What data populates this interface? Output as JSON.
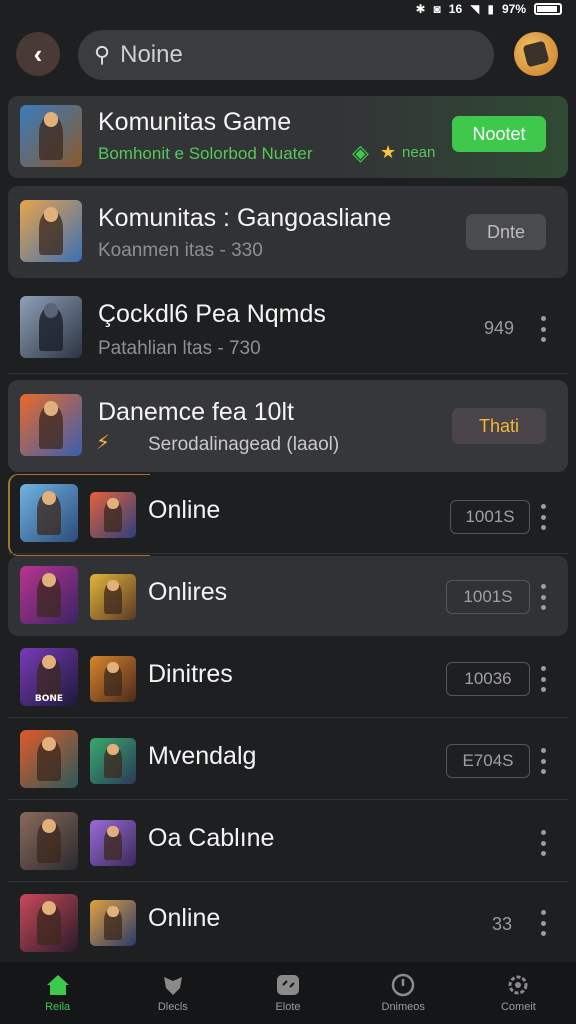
{
  "status": {
    "signal": "16",
    "battery": "97%"
  },
  "search": {
    "value": "Noine"
  },
  "rows": [
    {
      "title": "Komunitas Game",
      "subtitle": "Bomhonit e Solorbod Nuater",
      "subtitle_extra": "nean",
      "action": "Nootet"
    },
    {
      "title": "Komunitas : Gangoasliane",
      "subtitle": "Koanmen itas - 330",
      "action": "Dnte"
    },
    {
      "title": "Çockdl6 Pea Nqmds",
      "subtitle": "Patahlian ltas - 730",
      "count": "949"
    },
    {
      "title": "Danemce fea 10lt",
      "subtitle": "Serodalinagead (laaol)",
      "action": "Thati"
    },
    {
      "title": "Online",
      "badge": "1001S"
    },
    {
      "title": "Onlires",
      "badge": "1001S"
    },
    {
      "title": "Dinitres",
      "badge": "10036"
    },
    {
      "title": "Mvendalg",
      "badge": "E704S"
    },
    {
      "title": "Oa Cablıne"
    },
    {
      "title": "Online",
      "count": "33"
    }
  ],
  "nav": [
    {
      "label": "Reila"
    },
    {
      "label": "Dlecls"
    },
    {
      "label": "Elote"
    },
    {
      "label": "Dnimeos"
    },
    {
      "label": "Comeit"
    }
  ],
  "colors": {
    "accent": "#3ec94d",
    "background": "#1e1f21",
    "highlight_amber": "#f5b53a"
  }
}
